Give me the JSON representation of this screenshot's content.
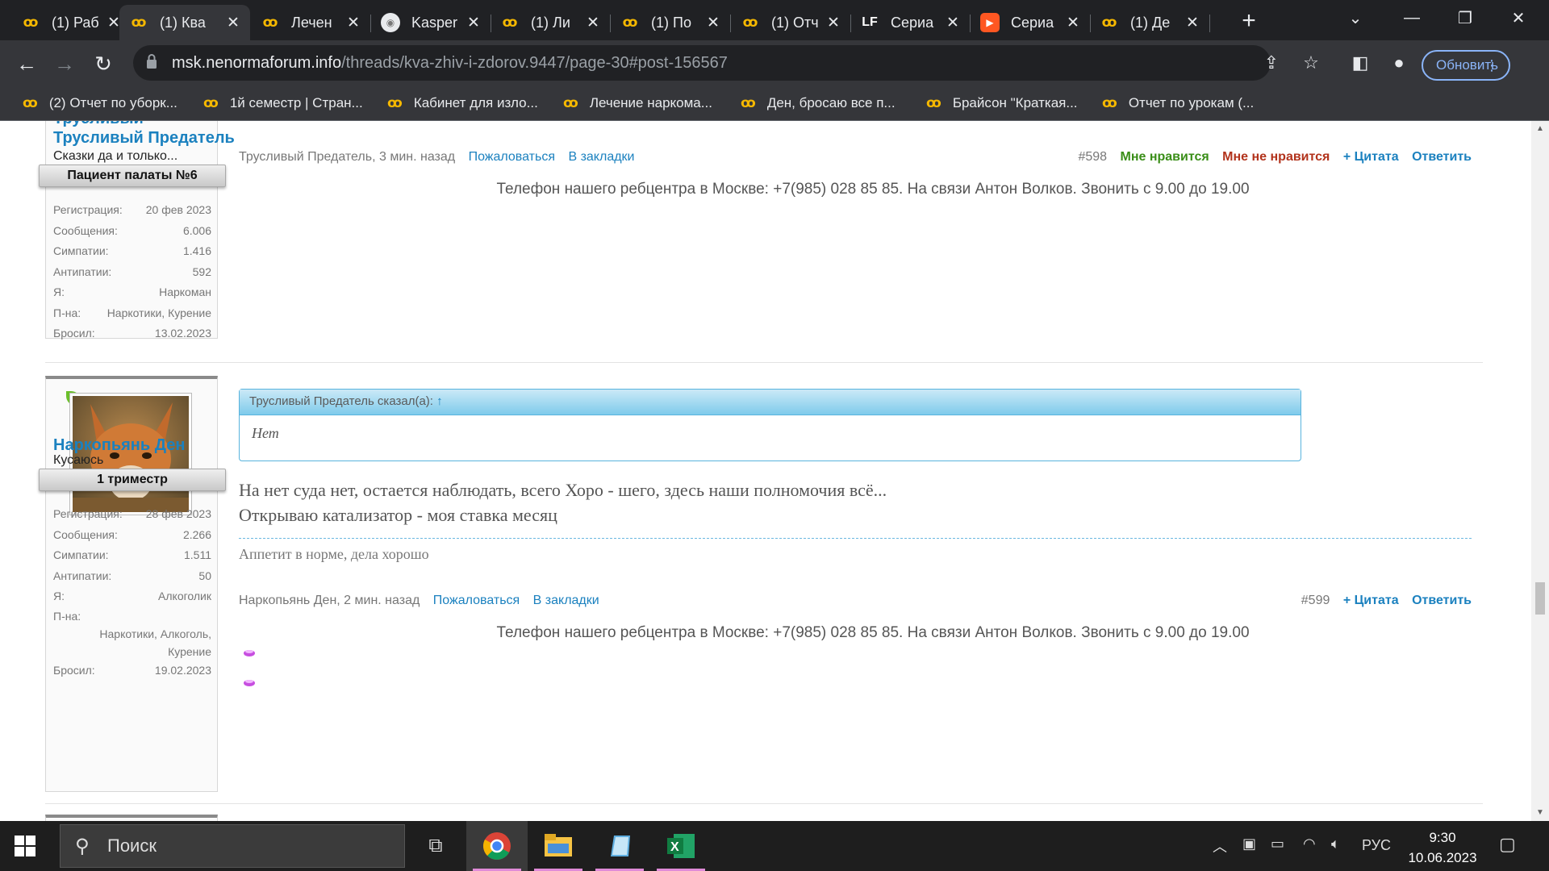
{
  "browser": {
    "tabs": [
      {
        "label": "(1) Раб",
        "favicon": "nf",
        "active": false
      },
      {
        "label": "(1) Ква",
        "favicon": "nf",
        "active": true
      },
      {
        "label": "Лечен",
        "favicon": "nf",
        "active": false
      },
      {
        "label": "Kasper",
        "favicon": "kas",
        "active": false
      },
      {
        "label": "(1) Ли",
        "favicon": "nf",
        "active": false
      },
      {
        "label": "(1) По",
        "favicon": "nf",
        "active": false
      },
      {
        "label": "(1) Отч",
        "favicon": "nf",
        "active": false
      },
      {
        "label": "Сериа",
        "favicon": "lf",
        "active": false
      },
      {
        "label": "Сериа",
        "favicon": "play",
        "active": false
      },
      {
        "label": "(1) Де",
        "favicon": "nf",
        "active": false
      }
    ],
    "favicon_text": {
      "nf": "ꝏ",
      "lf": "LF",
      "kas": "◉",
      "play": "▶"
    },
    "url_host": "msk.nenormaforum.info",
    "url_path": "/threads/kva-zhiv-i-zdorov.9447/page-30#post-156567",
    "update_label": "Обновить",
    "bookmarks": [
      "(2) Отчет по уборк...",
      "1й семестр | Стран...",
      "Кабинет для изло...",
      "Лечение наркома...",
      "Ден, бросаю все п...",
      "Брайсон \"Краткая...",
      "Отчет по урокам (..."
    ]
  },
  "post1": {
    "username": "Трусливый Предатель",
    "user_title": "Сказки да и только...",
    "rank": "Пациент палаты №6",
    "stats": [
      {
        "k": "Регистрация:",
        "v": "20 фев 2023"
      },
      {
        "k": "Сообщения:",
        "v": "6.006"
      },
      {
        "k": "Симпатии:",
        "v": "1.416"
      },
      {
        "k": "Антипатии:",
        "v": "592"
      },
      {
        "k": "Я:",
        "v": "Наркоман"
      },
      {
        "k": "П-на:",
        "v": "Наркотики, Курение"
      },
      {
        "k": "Бросил:",
        "v": "13.02.2023"
      }
    ],
    "meta": "Трусливый Предатель, 3 мин. назад",
    "report": "Пожаловаться",
    "bookmark": "В закладки",
    "number": "#598",
    "like": "Мне нравится",
    "dislike": "Мне не нравится",
    "quote": "+ Цитата",
    "reply": "Ответить",
    "signature_phone": "Телефон нашего ребцентра в Москве: +7(985) 028 85 85. На связи Антон Волков. Звонить с 9.00 до 19.00"
  },
  "post2": {
    "username": "Наркопьянь Ден",
    "user_title": "Кусаюсь",
    "rank": "1 триместр",
    "stats": [
      {
        "k": "Регистрация:",
        "v": "28 фев 2023"
      },
      {
        "k": "Сообщения:",
        "v": "2.266"
      },
      {
        "k": "Симпатии:",
        "v": "1.511"
      },
      {
        "k": "Антипатии:",
        "v": "50"
      },
      {
        "k": "Я:",
        "v": "Алкоголик"
      }
    ],
    "stat_pna_key": "П-на:",
    "stat_pna_value": "Наркотики, Алкоголь, Курение",
    "stat_quit_key": "Бросил:",
    "stat_quit_value": "19.02.2023",
    "quote_author": "Трусливый Предатель сказал(а):",
    "quote_arrow": "↑",
    "quote_text": "Нет",
    "message_line1": "На нет суда нет, остается наблюдать, всего Хоро - шего, здесь наши полномочия всё...",
    "message_line2": "Открываю катализатор - моя ставка месяц",
    "signature": "Аппетит в норме, дела хорошо",
    "meta": "Наркопьянь Ден, 2 мин. назад",
    "report": "Пожаловаться",
    "bookmark": "В закладки",
    "number": "#599",
    "quote": "+ Цитата",
    "reply": "Ответить",
    "signature_phone": "Телефон нашего ребцентра в Москве: +7(985) 028 85 85. На связи Антон Волков. Звонить с 9.00 до 19.00"
  },
  "taskbar": {
    "search_placeholder": "Поиск",
    "lang": "РУС",
    "time": "9:30",
    "date": "10.06.2023"
  }
}
